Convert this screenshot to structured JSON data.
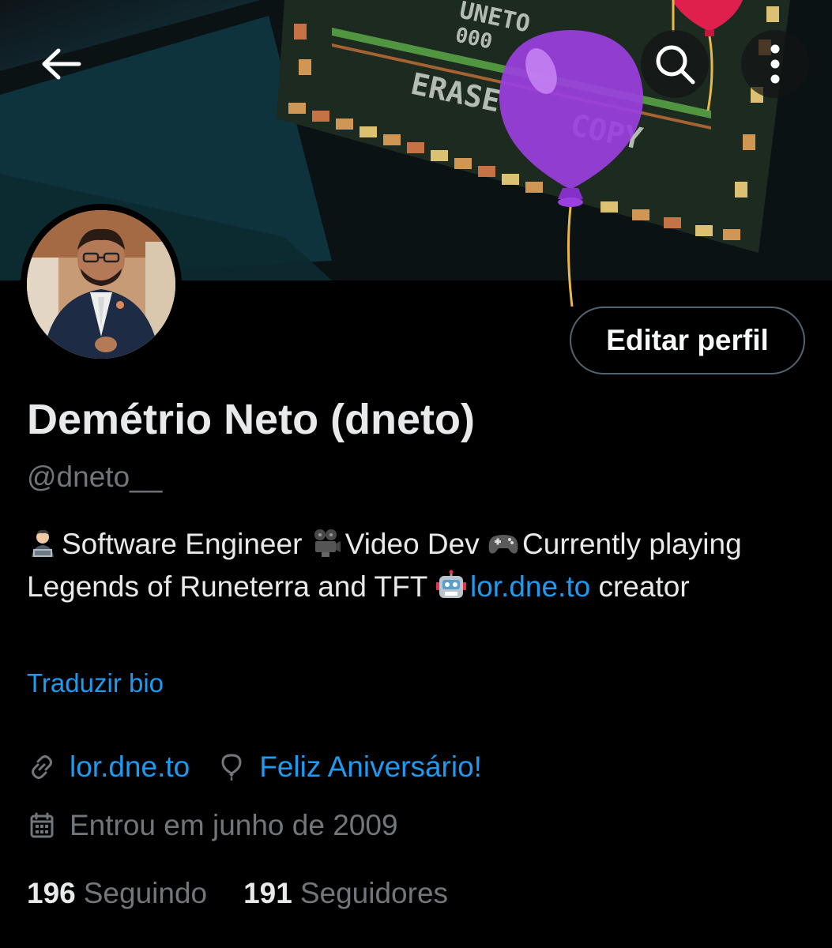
{
  "header": {
    "back_icon": "arrow-left-icon",
    "search_icon": "search-icon",
    "more_icon": "more-vertical-icon",
    "banner_text": {
      "top": "UNETO",
      "digits": "000",
      "erase": "ERASE",
      "copy": "COPY"
    }
  },
  "profile": {
    "edit_label": "Editar perfil",
    "display_name": "Demétrio Neto (dneto)",
    "handle": "@dneto__",
    "bio": {
      "part1": "Software Engineer",
      "part2": "Video Dev",
      "part3": "Currently playing Legends of Runeterra and TFT",
      "link": "lor.dne.to",
      "part4": "creator",
      "emojis": [
        "technologist-emoji",
        "film-projector-emoji",
        "game-controller-emoji",
        "robot-emoji"
      ]
    },
    "translate_label": "Traduzir bio",
    "website": "lor.dne.to",
    "birthday": "Feliz Aniversário!",
    "joined": "Entrou em junho de 2009",
    "following_count": "196",
    "following_label": "Seguindo",
    "followers_count": "191",
    "followers_label": "Seguidores"
  },
  "colors": {
    "background": "#000000",
    "primary_text": "#e7e9ea",
    "secondary_text": "#71767b",
    "link": "#1d9bf0",
    "balloon_purple": "#9b3fe0",
    "balloon_red": "#e0204c"
  }
}
